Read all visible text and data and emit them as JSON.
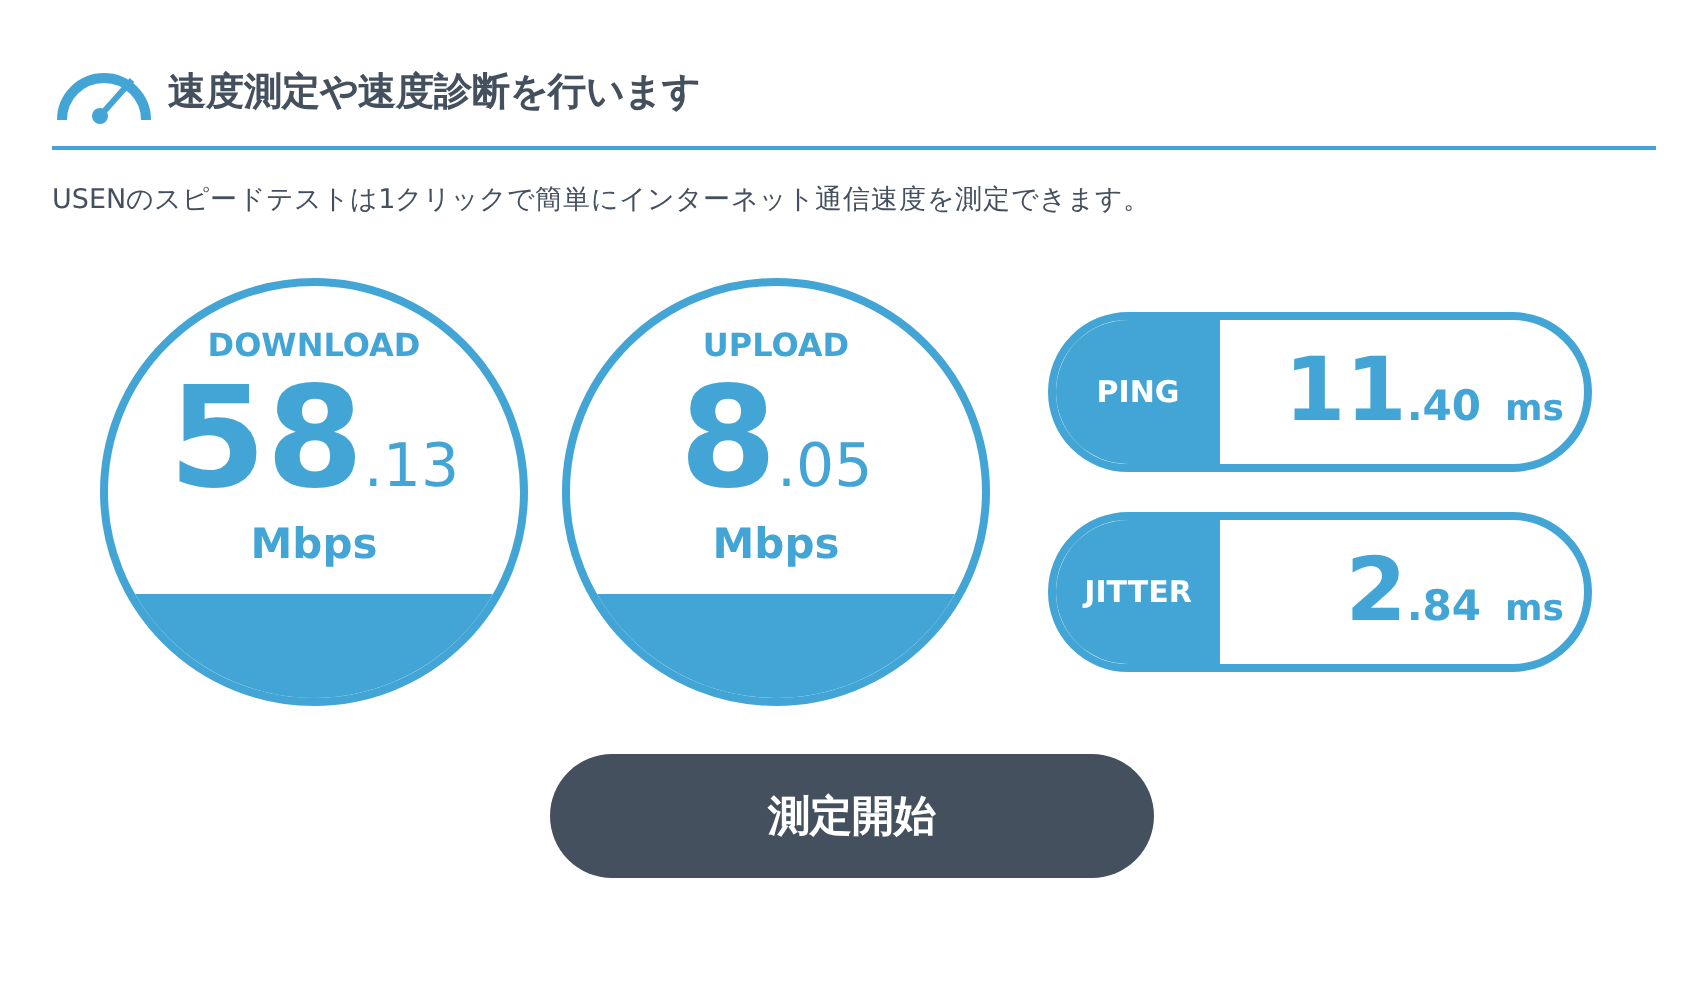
{
  "heading": "速度測定や速度診断を行います",
  "description": "USENのスピードテストは1クリックで簡単にインターネット通信速度を測定できます。",
  "gauges": [
    {
      "label": "DOWNLOAD",
      "integer": "58",
      "decimal": ".13",
      "unit": "Mbps"
    },
    {
      "label": "UPLOAD",
      "integer": "8",
      "decimal": ".05",
      "unit": "Mbps"
    }
  ],
  "pills": [
    {
      "label": "PING",
      "integer": "11",
      "decimal": ".40",
      "unit": "ms"
    },
    {
      "label": "JITTER",
      "integer": "2",
      "decimal": ".84",
      "unit": "ms"
    }
  ],
  "start_button": "測定開始"
}
